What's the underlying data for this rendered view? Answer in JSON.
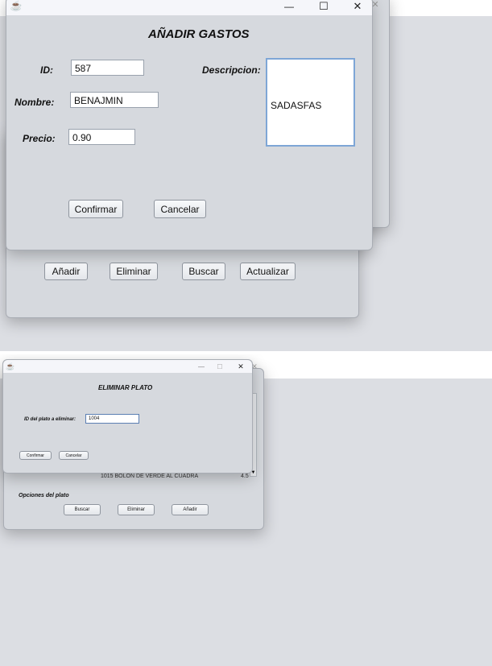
{
  "add_expense": {
    "title": "AÑADIR GASTOS",
    "labels": {
      "id": "ID:",
      "name": "Nombre:",
      "price": "Precio:",
      "description": "Descripcion:"
    },
    "values": {
      "id": "587",
      "name": "BENAJMIN",
      "price": "0.90",
      "description": "SADASFAS"
    },
    "buttons": {
      "confirm": "Confirmar",
      "cancel": "Cancelar"
    }
  },
  "main_top": {
    "buttons": {
      "add": "Añadir",
      "delete": "Eliminar",
      "search": "Buscar",
      "update": "Actualizar"
    }
  },
  "delete_dish": {
    "title": "ELIMINAR PLATO",
    "label": "ID del plato a eliminar:",
    "value": "1004",
    "buttons": {
      "confirm": "Confirmar",
      "cancel": "Cancelar"
    }
  },
  "main_bottom": {
    "list_row": "1015   BOLÓN DE VERDE AL CUADRA",
    "list_row_value": "4.5",
    "section_label": "Opciones del plato",
    "buttons": {
      "search": "Buscar",
      "delete": "Eliminar",
      "add": "Añadir"
    }
  },
  "window_controls": {
    "minimize": "—",
    "maximize": "☐",
    "close": "✕"
  },
  "icons": {
    "java": "☕"
  },
  "colors": {
    "desktop": "#dcdee3",
    "window": "#d6d9de",
    "titlebar": "#f5f6fa",
    "focus_border": "#7ea6d6"
  }
}
